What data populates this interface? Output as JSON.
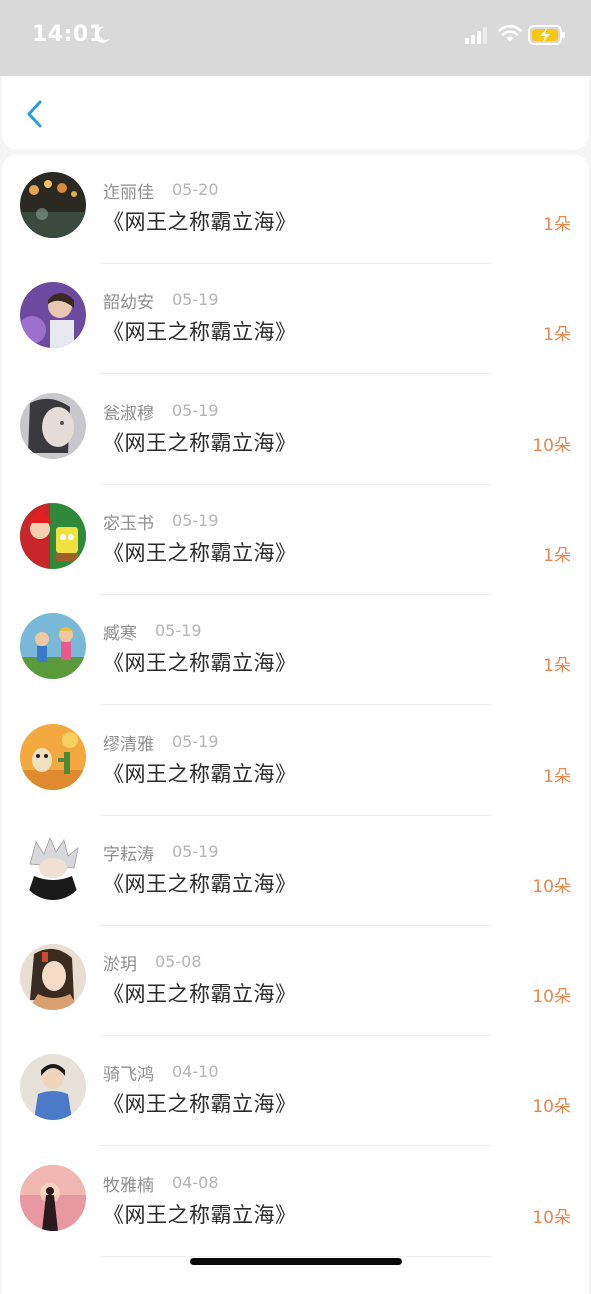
{
  "status_bar": {
    "time": "14:01",
    "icons": [
      "moon-icon",
      "signal-icon",
      "wifi-icon",
      "battery-charging-icon"
    ],
    "battery_color": "#f5c518"
  },
  "nav": {
    "back_icon": "chevron-left-icon",
    "accent_color": "#2a9be8"
  },
  "list": {
    "items": [
      {
        "name": "迮丽佳",
        "date": "05-20",
        "title": "《网王之称霸立海》",
        "count": "1朵",
        "avatar": "avatar-bokeh-lights"
      },
      {
        "name": "韶幼安",
        "date": "05-19",
        "title": "《网王之称霸立海》",
        "count": "1朵",
        "avatar": "avatar-boy-purple"
      },
      {
        "name": "瓮淑穆",
        "date": "05-19",
        "title": "《网王之称霸立海》",
        "count": "10朵",
        "avatar": "avatar-girl-grey"
      },
      {
        "name": "宓玉书",
        "date": "05-19",
        "title": "《网王之称霸立海》",
        "count": "1朵",
        "avatar": "avatar-cartoon-christmas"
      },
      {
        "name": "臧寒",
        "date": "05-19",
        "title": "《网王之称霸立海》",
        "count": "1朵",
        "avatar": "avatar-cartoon-kids"
      },
      {
        "name": "缪清雅",
        "date": "05-19",
        "title": "《网王之称霸立海》",
        "count": "1朵",
        "avatar": "avatar-cartoon-desert"
      },
      {
        "name": "字耘涛",
        "date": "05-19",
        "title": "《网王之称霸立海》",
        "count": "10朵",
        "avatar": "avatar-anime-silver-hair"
      },
      {
        "name": "淤玥",
        "date": "05-08",
        "title": "《网王之称霸立海》",
        "count": "10朵",
        "avatar": "avatar-ancient-girl"
      },
      {
        "name": "骑飞鸿",
        "date": "04-10",
        "title": "《网王之称霸立海》",
        "count": "10朵",
        "avatar": "avatar-boy-denim"
      },
      {
        "name": "牧雅楠",
        "date": "04-08",
        "title": "《网王之称霸立海》",
        "count": "10朵",
        "avatar": "avatar-sunset-silhouette"
      }
    ]
  },
  "colors": {
    "count": "#e8884e",
    "name": "#8f8f8f",
    "title": "#2a2a2a"
  }
}
